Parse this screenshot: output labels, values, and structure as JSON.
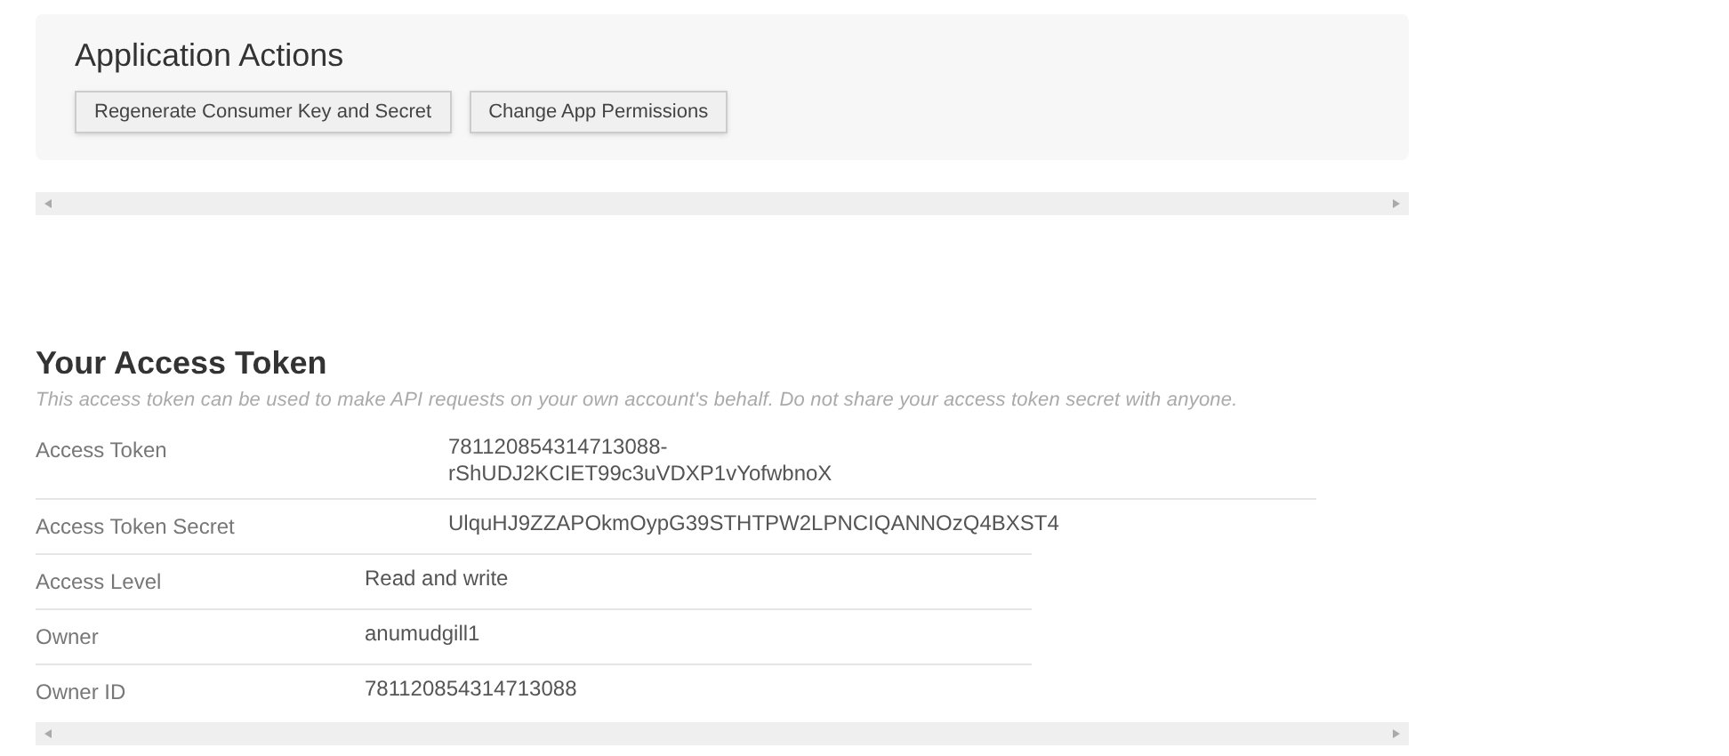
{
  "application_actions": {
    "title": "Application Actions",
    "buttons": [
      "Regenerate Consumer Key and Secret",
      "Change App Permissions"
    ]
  },
  "access_token": {
    "title": "Your Access Token",
    "description": "This access token can be used to make API requests on your own account's behalf. Do not share your access token secret with anyone.",
    "token_rows": [
      {
        "label": "Access Token",
        "value": [
          "781120854314713088-",
          "rShUDJ2KCIET99c3uVDXP1vYofwbnoX"
        ]
      },
      {
        "label": "Access Token Secret",
        "value": [
          "UlquHJ9ZZAPOkmOypG39STHTPW2LPNCIQANNOzQ4BXST4"
        ]
      }
    ],
    "detail_rows": [
      {
        "label": "Access Level",
        "value": [
          "Read and write"
        ]
      },
      {
        "label": "Owner",
        "value": [
          "anumudgill1"
        ]
      },
      {
        "label": "Owner ID",
        "value": [
          "781120854314713088"
        ]
      }
    ]
  }
}
